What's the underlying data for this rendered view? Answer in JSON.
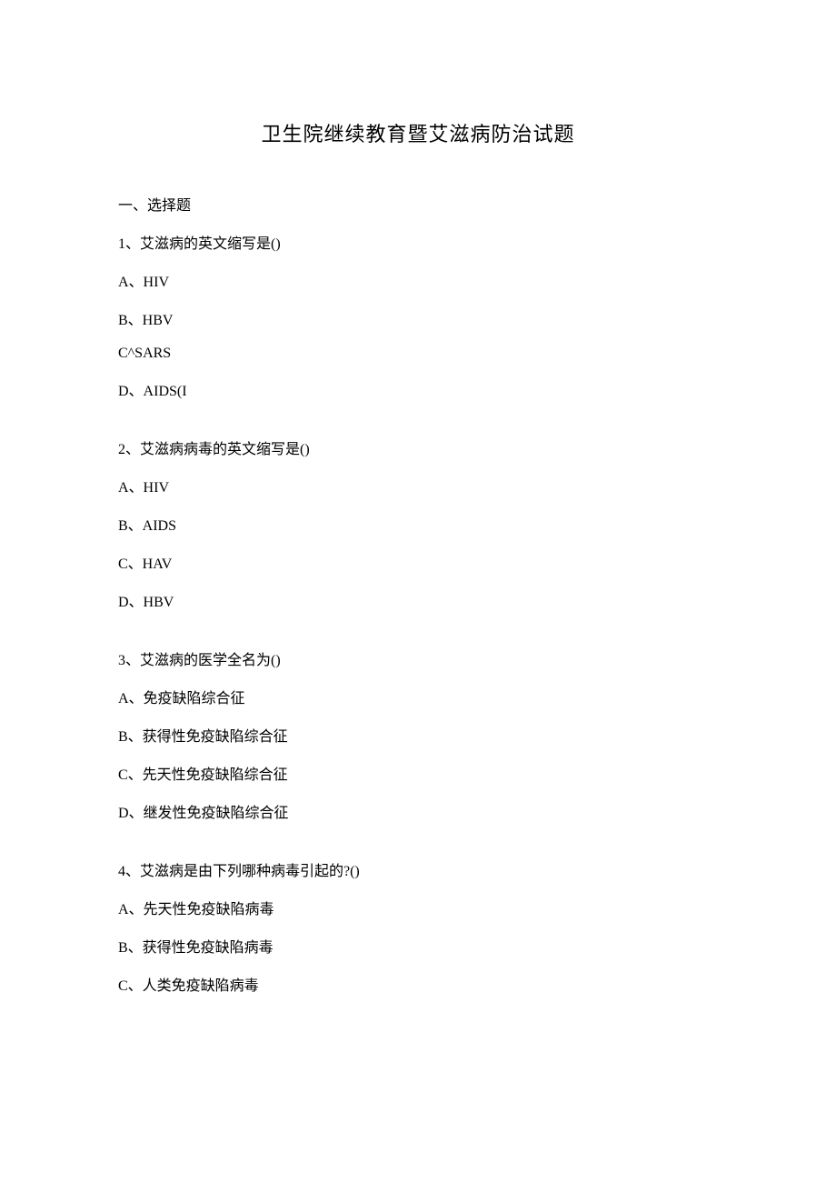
{
  "title": "卫生院继续教育暨艾滋病防治试题",
  "section_header": "一、选择题",
  "questions": [
    {
      "text": "1、艾滋病的英文缩写是()",
      "options": [
        "A、HIV",
        "B、HBV",
        "C^SARS",
        "D、AIDS(I"
      ]
    },
    {
      "text": "2、艾滋病病毒的英文缩写是()",
      "options": [
        "A、HIV",
        "B、AIDS",
        "C、HAV",
        "D、HBV"
      ]
    },
    {
      "text": "3、艾滋病的医学全名为()",
      "options": [
        "A、免疫缺陷综合征",
        "B、获得性免疫缺陷综合征",
        "C、先天性免疫缺陷综合征",
        "D、继发性免疫缺陷综合征"
      ]
    },
    {
      "text": "4、艾滋病是由下列哪种病毒引起的?()",
      "options": [
        "A、先天性免疫缺陷病毒",
        "B、获得性免疫缺陷病毒",
        "C、人类免疫缺陷病毒"
      ]
    }
  ]
}
